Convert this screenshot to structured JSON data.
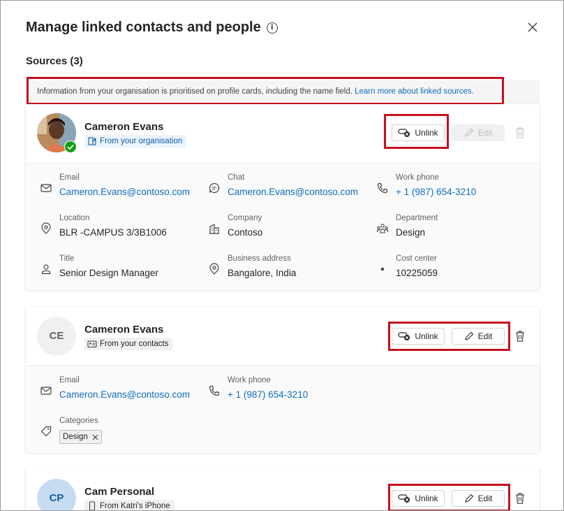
{
  "dialog": {
    "title": "Manage linked contacts and people",
    "sources_label": "Sources (3)",
    "notice_text": "Information from your organisation is prioritised on profile cards, including the name field. ",
    "notice_link": "Learn more about linked sources."
  },
  "buttons": {
    "unlink": "Unlink",
    "edit": "Edit"
  },
  "cards": [
    {
      "name": "Cameron Evans",
      "source": "From your organisation",
      "fields": [
        {
          "label": "Email",
          "value": "Cameron.Evans@contoso.com",
          "icon": "mail-icon"
        },
        {
          "label": "Chat",
          "value": "Cameron.Evans@contoso.com",
          "icon": "chat-icon"
        },
        {
          "label": "Work phone",
          "value": "+ 1 (987) 654-3210",
          "icon": "phone-icon"
        },
        {
          "label": "Location",
          "value": "BLR -CAMPUS 3/3B1006",
          "icon": "location-icon"
        },
        {
          "label": "Company",
          "value": "Contoso",
          "icon": "building-icon"
        },
        {
          "label": "Department",
          "value": "Design",
          "icon": "people-team-icon"
        },
        {
          "label": "Title",
          "value": "Senior Design Manager",
          "icon": "person-icon"
        },
        {
          "label": "Business address",
          "value": "Bangalore, India",
          "icon": "location-icon"
        },
        {
          "label": "Cost  center",
          "value": "10225059",
          "icon": "dot-icon"
        }
      ]
    },
    {
      "name": "Cameron Evans",
      "initials": "CE",
      "source": "From your contacts",
      "fields": [
        {
          "label": "Email",
          "value": "Cameron.Evans@contoso.com",
          "icon": "mail-icon"
        },
        {
          "label": "Work phone",
          "value": "+ 1 (987) 654-3210",
          "icon": "phone-icon"
        },
        {
          "label": "Categories",
          "value": "Design",
          "icon": "tag-icon"
        }
      ]
    },
    {
      "name": "Cam Personal",
      "initials": "CP",
      "source": "From Katri's iPhone"
    }
  ],
  "colors": {
    "link": "#0f6cbd",
    "highlight": "#c50f1f",
    "online": "#13a10e",
    "avatar_cp": "#c7dcf3"
  }
}
